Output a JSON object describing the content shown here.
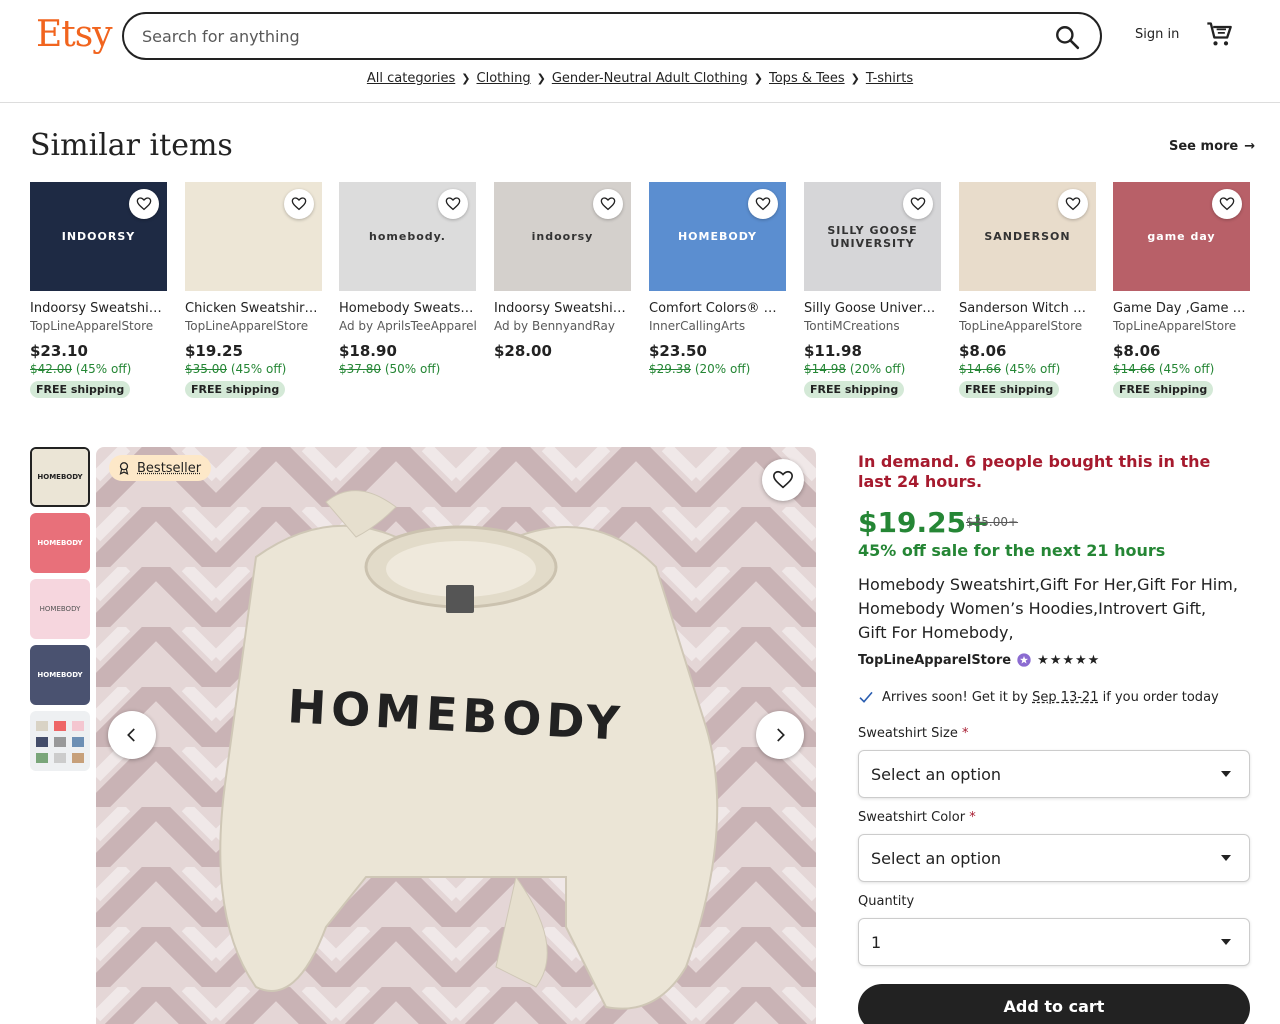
{
  "header": {
    "logo": "Etsy",
    "search_placeholder": "Search for anything",
    "signin": "Sign in"
  },
  "breadcrumbs": [
    "All categories",
    "Clothing",
    "Gender-Neutral Adult Clothing",
    "Tops & Tees",
    "T-shirts"
  ],
  "similar": {
    "title": "Similar items",
    "see_more": "See more",
    "items": [
      {
        "title": "Indoorsy Sweatshirt, Indoorsy Shirt",
        "shop": "TopLineApparelStore",
        "price": "$23.10",
        "orig": "$42.00",
        "off": "(45% off)",
        "shipping": "FREE shipping",
        "img_text": "INDOORSY",
        "img_color": "#1e2a44"
      },
      {
        "title": "Chicken Sweatshirt, Chicken Shirt",
        "shop": "TopLineApparelStore",
        "price": "$19.25",
        "orig": "$35.00",
        "off": "(45% off)",
        "shipping": "FREE shipping",
        "img_text": "",
        "img_color": "#ede6d6"
      },
      {
        "title": "Homebody Sweatshirt, Homebody",
        "shop": "Ad by AprilsTeeApparel",
        "price": "$18.90",
        "orig": "$37.80",
        "off": "(50% off)",
        "shipping": "",
        "img_text": "homebody.",
        "img_color": "#dcdcdc"
      },
      {
        "title": "Indoorsy Sweatshirt, Indoorsy",
        "shop": "Ad by BennyandRay",
        "price": "$28.00",
        "orig": "",
        "off": "",
        "shipping": "",
        "img_text": "indoorsy",
        "img_color": "#d4d0cc"
      },
      {
        "title": "Comfort Colors® Homebody",
        "shop": "InnerCallingArts",
        "price": "$23.50",
        "orig": "$29.38",
        "off": "(20% off)",
        "shipping": "",
        "img_text": "HOMEBODY",
        "img_color": "#5b8ed0"
      },
      {
        "title": "Silly Goose University",
        "shop": "TontiMCreations",
        "price": "$11.98",
        "orig": "$14.98",
        "off": "(20% off)",
        "shipping": "FREE shipping",
        "img_text": "SILLY GOOSE UNIVERSITY",
        "img_color": "#d6d6d8"
      },
      {
        "title": "Sanderson Witch Museum",
        "shop": "TopLineApparelStore",
        "price": "$8.06",
        "orig": "$14.66",
        "off": "(45% off)",
        "shipping": "FREE shipping",
        "img_text": "SANDERSON",
        "img_color": "#e8dccb"
      },
      {
        "title": "Game Day ,Game Day Shirt",
        "shop": "TopLineApparelStore",
        "price": "$8.06",
        "orig": "$14.66",
        "off": "(45% off)",
        "shipping": "FREE shipping",
        "img_text": "game day",
        "img_color": "#b86068"
      }
    ]
  },
  "gallery": {
    "badge": "Bestseller",
    "main_text": "HOMEBODY",
    "thumbs": [
      "#ebe5d6",
      "#e8707a",
      "#f6d6de",
      "#4a5270",
      "#e4e6e8"
    ]
  },
  "listing": {
    "demand": "In demand. 6 people bought this in the last 24 hours.",
    "price": "$19.25+",
    "was": "$35.00+",
    "sale": "45% off sale for the next 21 hours",
    "title": "Homebody Sweatshirt,Gift For Her,Gift For Him, Homebody Women’s Hoodies,Introvert Gift, Gift For Homebody,",
    "shop": "TopLineApparelStore",
    "stars": "★★★★★",
    "arrives_prefix": "Arrives soon! Get it by",
    "arrives_date": "Sep 13-21",
    "arrives_suffix": "if you order today",
    "size_label": "Sweatshirt Size",
    "size_value": "Select an option",
    "color_label": "Sweatshirt Color",
    "color_value": "Select an option",
    "qty_label": "Quantity",
    "qty_value": "1",
    "add_to_cart": "Add to cart"
  }
}
